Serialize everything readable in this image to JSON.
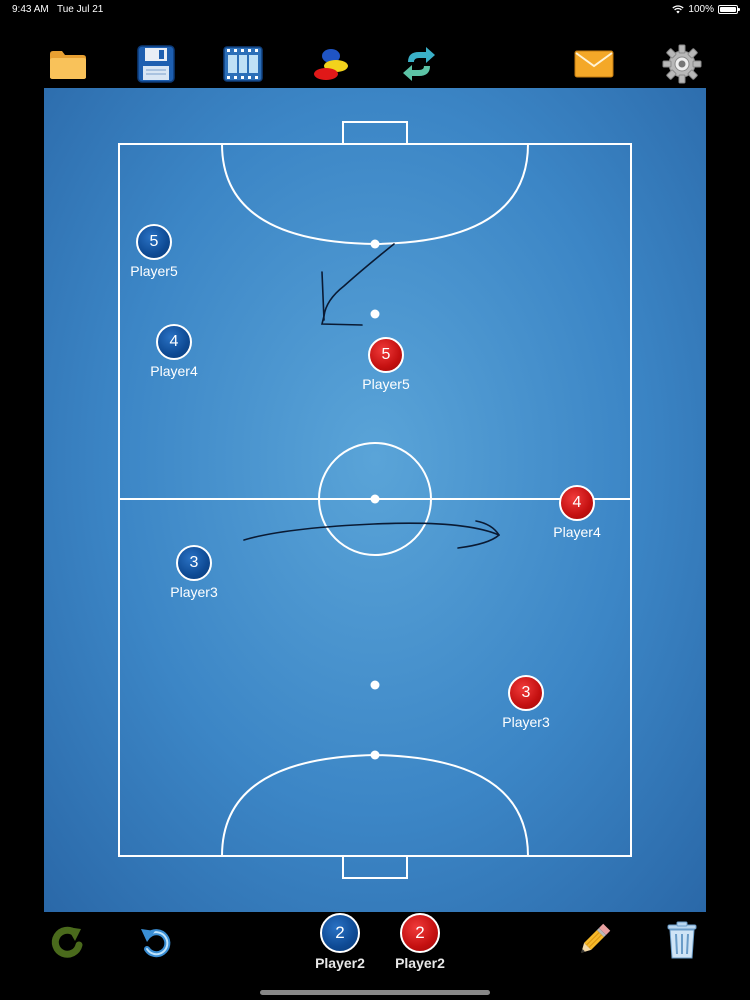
{
  "status": {
    "time": "9:43 AM",
    "date": "Tue Jul 21",
    "battery": "100%"
  },
  "toolbar": {
    "icons": [
      "folder-icon",
      "save-icon",
      "film-icon",
      "markers-icon",
      "swap-icon",
      "mail-icon",
      "gear-icon"
    ]
  },
  "team_colors": {
    "blue": "#0e4a94",
    "red": "#c41010",
    "field": "#3c86c6"
  },
  "players": {
    "blue5": {
      "number": "5",
      "name": "Player5"
    },
    "blue4": {
      "number": "4",
      "name": "Player4"
    },
    "blue3": {
      "number": "3",
      "name": "Player3"
    },
    "red5": {
      "number": "5",
      "name": "Player5"
    },
    "red4": {
      "number": "4",
      "name": "Player4"
    },
    "red3": {
      "number": "3",
      "name": "Player3"
    }
  },
  "bottom_bar": {
    "blue_token": {
      "number": "2",
      "name": "Player2"
    },
    "red_token": {
      "number": "2",
      "name": "Player2"
    },
    "icons": [
      "redo-icon",
      "undo-icon",
      "pencil-icon",
      "trash-icon"
    ]
  }
}
